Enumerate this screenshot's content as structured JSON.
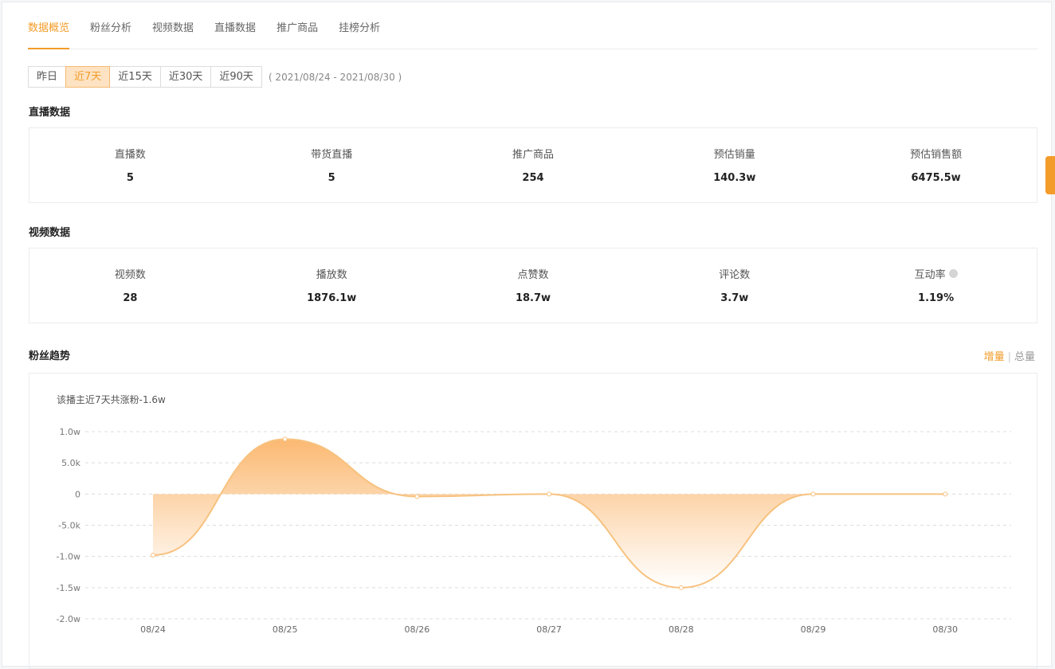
{
  "tabs": [
    "数据概览",
    "粉丝分析",
    "视频数据",
    "直播数据",
    "推广商品",
    "挂榜分析"
  ],
  "active_tab": 0,
  "ranges": [
    "昨日",
    "近7天",
    "近15天",
    "近30天",
    "近90天"
  ],
  "active_range": 1,
  "date_range": "( 2021/08/24 - 2021/08/30 )",
  "live_section": {
    "title": "直播数据",
    "stats": [
      {
        "label": "直播数",
        "value": "5"
      },
      {
        "label": "带货直播",
        "value": "5"
      },
      {
        "label": "推广商品",
        "value": "254"
      },
      {
        "label": "预估销量",
        "value": "140.3w"
      },
      {
        "label": "预估销售额",
        "value": "6475.5w"
      }
    ]
  },
  "video_section": {
    "title": "视频数据",
    "stats": [
      {
        "label": "视频数",
        "value": "28"
      },
      {
        "label": "播放数",
        "value": "1876.1w"
      },
      {
        "label": "点赞数",
        "value": "18.7w"
      },
      {
        "label": "评论数",
        "value": "3.7w"
      },
      {
        "label": "互动率",
        "value": "1.19%",
        "info_icon": "info-icon"
      }
    ]
  },
  "fans_section": {
    "title": "粉丝趋势",
    "toggle_increment": "增量",
    "toggle_sep": "|",
    "toggle_total": "总量",
    "summary": "该播主近7天共涨粉-1.6w"
  },
  "colors": {
    "accent": "#f39c2a",
    "line": "#f7c27f",
    "fill_top": "#fbb56a"
  },
  "chart_data": {
    "type": "area",
    "categories": [
      "08/24",
      "08/25",
      "08/26",
      "08/27",
      "08/28",
      "08/29",
      "08/30"
    ],
    "values": [
      -9800,
      8800,
      -400,
      0,
      -15000,
      0,
      0
    ],
    "y_ticks": [
      10000,
      5000,
      0,
      -5000,
      -10000,
      -15000,
      -20000
    ],
    "y_tick_labels": [
      "1.0w",
      "5.0k",
      "0",
      "-5.0k",
      "-1.0w",
      "-1.5w",
      "-2.0w"
    ],
    "ylim": [
      -20000,
      10000
    ],
    "grid": true
  }
}
